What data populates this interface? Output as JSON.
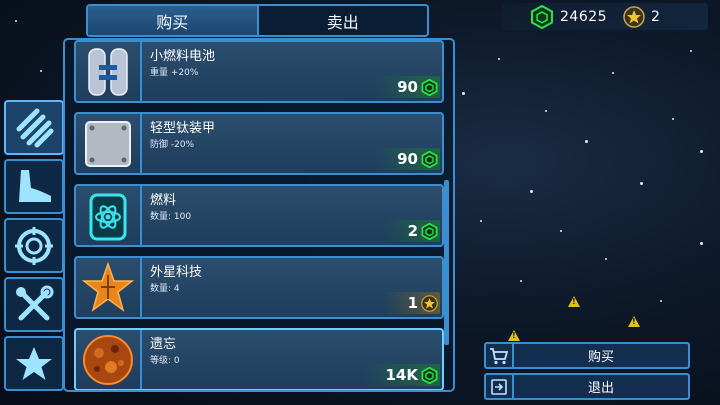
{
  "tabs": {
    "buy": "购买",
    "sell": "卖出"
  },
  "currency": {
    "credits": "24625",
    "credits_icon": "green-cube-icon",
    "stars": "2",
    "stars_icon": "gold-star-coin-icon"
  },
  "categories": [
    {
      "icon": "pipes-icon"
    },
    {
      "icon": "boot-icon"
    },
    {
      "icon": "crosshair-icon"
    },
    {
      "icon": "tools-icon"
    },
    {
      "icon": "star-icon"
    }
  ],
  "items": [
    {
      "name": "小燃料电池",
      "stat": "重量 +20%",
      "price": "90",
      "price_icon": "green-cube-icon",
      "thumb_icon": "fuel-tanks-icon"
    },
    {
      "name": "轻型钛装甲",
      "stat": "防御 -20%",
      "price": "90",
      "price_icon": "green-cube-icon",
      "thumb_icon": "armor-plate-icon"
    },
    {
      "name": "燃料",
      "stat": "数量: 100",
      "price": "2",
      "price_icon": "green-cube-icon",
      "thumb_icon": "atom-canister-icon"
    },
    {
      "name": "外星科技",
      "stat": "数量: 4",
      "price": "1",
      "price_icon": "gold-star-coin-icon",
      "thumb_icon": "alien-star-icon"
    },
    {
      "name": "遗忘",
      "stat": "等级: 0",
      "price": "14K",
      "price_icon": "green-cube-icon",
      "thumb_icon": "planet-icon"
    }
  ],
  "actions": {
    "buy": "购买",
    "exit": "退出"
  },
  "colors": {
    "accent": "#3b8fd0",
    "price_green": "#2fe04a",
    "gold": "#e0b020"
  }
}
